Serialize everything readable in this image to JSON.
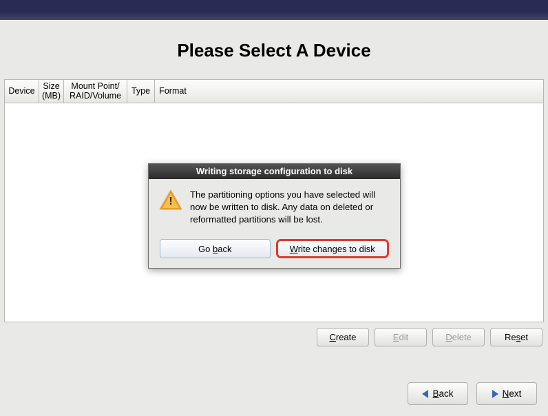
{
  "header": {
    "title": "Please Select A Device"
  },
  "table": {
    "columns": {
      "device": "Device",
      "size": "Size\n(MB)",
      "mount": "Mount Point/\nRAID/Volume",
      "type": "Type",
      "format": "Format"
    }
  },
  "actions": {
    "create": "Create",
    "create_u": "C",
    "edit": "Edit",
    "edit_u": "E",
    "delete": "Delete",
    "delete_u": "D",
    "reset": "Reset",
    "reset_u": "s"
  },
  "nav": {
    "back": "Back",
    "back_u": "B",
    "next": "Next",
    "next_u": "N"
  },
  "dialog": {
    "title": "Writing storage configuration to disk",
    "message": "The partitioning options you have selected will now be written to disk.  Any data on deleted or reformatted partitions will be lost.",
    "go_back": "Go back",
    "go_back_u": "b",
    "write": "Write changes to disk",
    "write_u": "W"
  }
}
